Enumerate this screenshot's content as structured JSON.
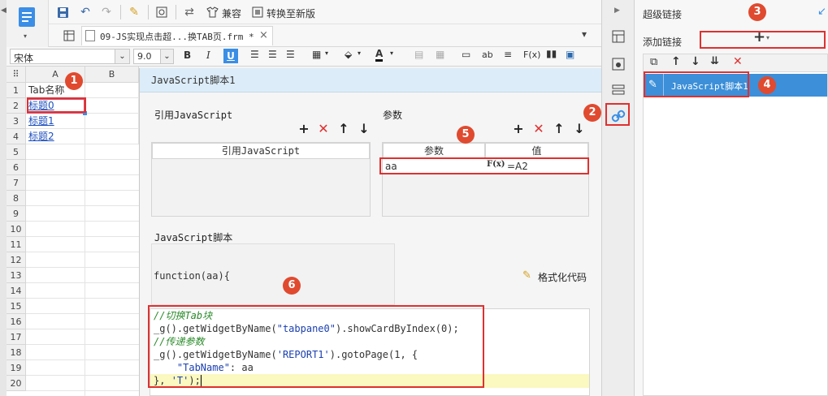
{
  "toolbar": {
    "compat_label": "兼容",
    "convert_label": "转换至新版"
  },
  "tab": {
    "title": "09-JS实现点击超...换TAB页.frm *"
  },
  "format": {
    "font_name": "宋体",
    "font_size": "9.0"
  },
  "sheet": {
    "columns": [
      "A",
      "B"
    ],
    "rows": [
      "1",
      "2",
      "3",
      "4",
      "5",
      "6",
      "7",
      "8",
      "9",
      "10",
      "11",
      "12",
      "13",
      "14",
      "15",
      "16",
      "17",
      "18",
      "19",
      "20"
    ],
    "cells": {
      "a1": "Tab名称",
      "a2": "标题0",
      "a3": "标题1",
      "a4": "标题2"
    }
  },
  "dialog": {
    "title": "JavaScript脚本1",
    "ref_js_label": "引用JavaScript",
    "ref_js_header": "引用JavaScript",
    "params_label": "参数",
    "param_header": "参数",
    "value_header": "值",
    "param_name": "aa",
    "param_value": "=A2",
    "formula_label": "F(x)",
    "script_label": "JavaScript脚本",
    "func_signature": "function(aa){",
    "format_code_label": "格式化代码"
  },
  "code": {
    "line1": "//切换Tab块",
    "line2_a": "_g().getWidgetByName(",
    "line2_s": "\"tabpane0\"",
    "line2_b": ").showCardByIndex(0);",
    "line3": "//传递参数",
    "line4_a": "_g().getWidgetByName(",
    "line4_s": "'REPORT1'",
    "line4_b": ").gotoPage(1, {",
    "line5_s": "    \"TabName\"",
    "line5_b": ": aa",
    "line6_a": "}, ",
    "line6_s": "'T'",
    "line6_b": ");"
  },
  "right_panel": {
    "title": "超级链接",
    "add_link_label": "添加链接",
    "add_button": "+",
    "list_items": [
      "JavaScript脚本1"
    ]
  },
  "markers": [
    "1",
    "2",
    "3",
    "4",
    "5",
    "6"
  ],
  "colors": {
    "accent": "#3a8ee6",
    "marker": "#e04a2f",
    "selected": "#3c8fd8",
    "highlight_line": "#fbf8c0"
  }
}
